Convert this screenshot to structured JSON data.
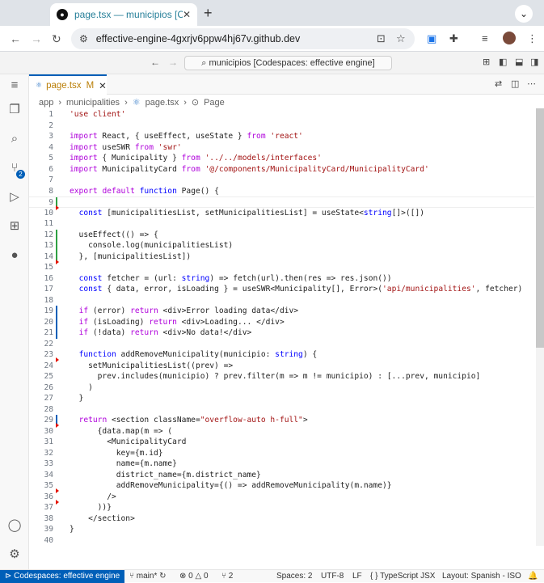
{
  "browser": {
    "tab_title": "page.tsx — municipios [Code",
    "url": "effective-engine-4gxrjv6ppw4hj67v.github.dev"
  },
  "vscode": {
    "command_center": "municipios [Codespaces: effective engine]",
    "editor_tab": {
      "name": "page.tsx",
      "status": "M"
    },
    "breadcrumbs": [
      "app",
      "municipalities",
      "page.tsx",
      "Page"
    ],
    "scm_badge": "2"
  },
  "code_lines": [
    "'use client'",
    "",
    "import React, { useEffect, useState } from 'react'",
    "import useSWR from 'swr'",
    "import { Municipality } from '../../models/interfaces'",
    "import MunicipalityCard from '@/components/MunicipalityCard/MunicipalityCard'",
    "",
    "export default function Page() {",
    "",
    "  const [municipalitiesList, setMunicipalitiesList] = useState<string[]>([])",
    "",
    "  useEffect(() => {",
    "    console.log(municipalitiesList)",
    "  }, [municipalitiesList])",
    "",
    "  const fetcher = (url: string) => fetch(url).then(res => res.json())",
    "  const { data, error, isLoading } = useSWR<Municipality[], Error>('api/municipalities', fetcher)",
    "",
    "  if (error) return <div>Error loading data</div>",
    "  if (isLoading) return <div>Loading... </div>",
    "  if (!data) return <div>No data!</div>",
    "",
    "  function addRemoveMunicipality(municipio: string) {",
    "    setMunicipalitiesList((prev) =>",
    "      prev.includes(municipio) ? prev.filter(m => m != municipio) : [...prev, municipio]",
    "    )",
    "  }",
    "",
    "  return <section className=\"overflow-auto h-full\">",
    "      {data.map(m => (",
    "        <MunicipalityCard",
    "          key={m.id}",
    "          name={m.name}",
    "          district_name={m.district_name}",
    "          addRemoveMunicipality={() => addRemoveMunicipality(m.name)}",
    "        />",
    "      ))}",
    "    </section>",
    "}",
    ""
  ],
  "status": {
    "remote": "Codespaces: effective engine",
    "branch": "main*",
    "errors": "0",
    "warnings": "0",
    "ports": "2",
    "spaces": "Spaces: 2",
    "encoding": "UTF-8",
    "eol": "LF",
    "language": "TypeScript JSX",
    "layout": "Layout: Spanish - ISO"
  }
}
